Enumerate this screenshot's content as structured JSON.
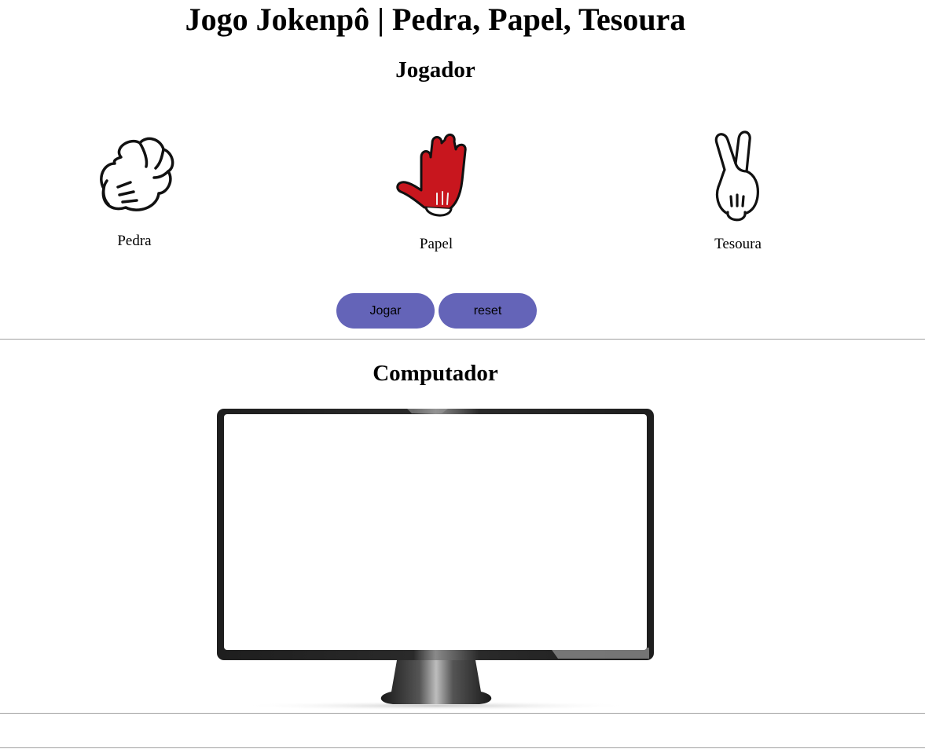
{
  "page": {
    "title": "Jogo Jokenpô | Pedra, Papel, Tesoura"
  },
  "player": {
    "heading": "Jogador",
    "choices": [
      {
        "label": "Pedra",
        "icon": "rock-hand-icon",
        "selected": false
      },
      {
        "label": "Papel",
        "icon": "paper-hand-icon",
        "selected": true
      },
      {
        "label": "Tesoura",
        "icon": "scissors-hand-icon",
        "selected": false
      }
    ],
    "play_label": "Jogar",
    "reset_label": "reset"
  },
  "computer": {
    "heading": "Computador",
    "display_icon": "monitor-icon"
  },
  "colors": {
    "button": "#6464b8",
    "selected_hand": "#c8161e",
    "divider": "#a0a0a0"
  }
}
